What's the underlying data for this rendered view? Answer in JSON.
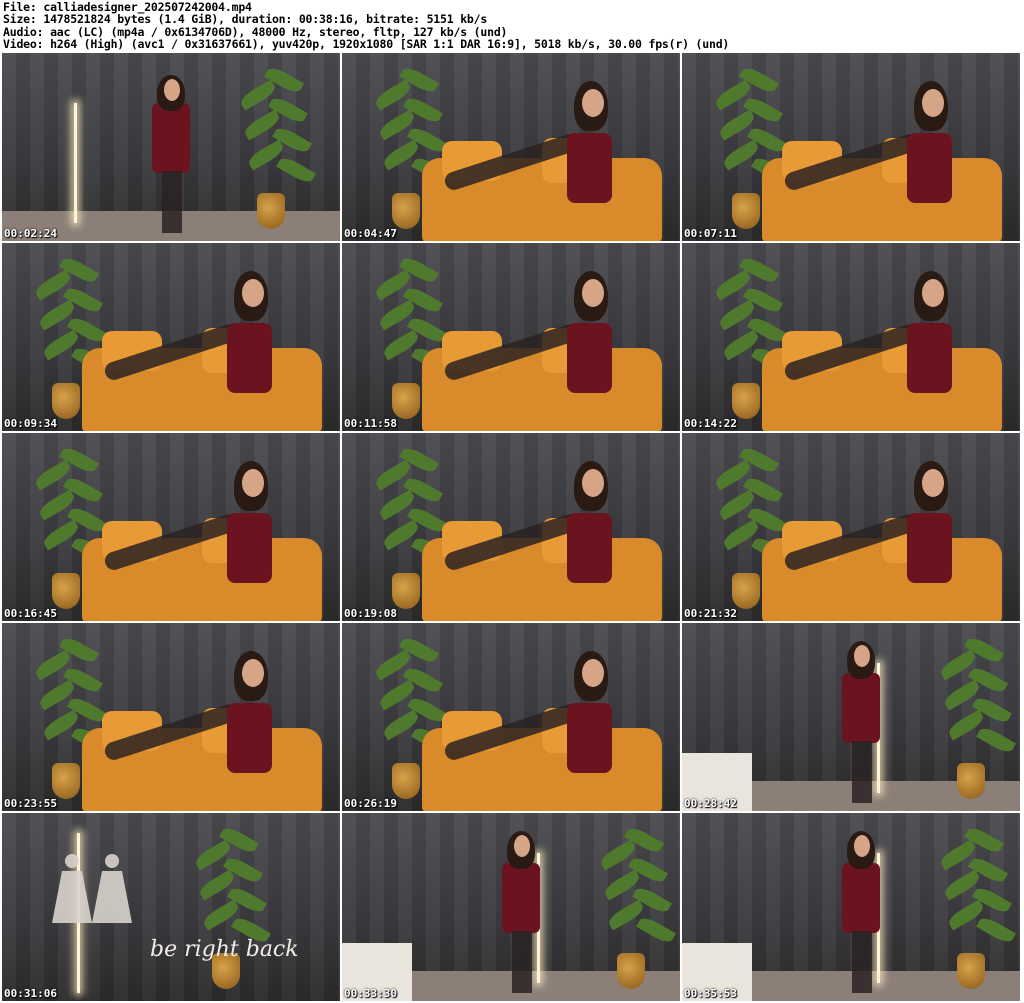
{
  "header": {
    "file_line": "File: calliadesigner_202507242004.mp4",
    "size_line": "Size: 1478521824 bytes (1.4 GiB), duration: 00:38:16, bitrate: 5151 kb/s",
    "audio_line": "Audio: aac (LC) (mp4a / 0x6134706D), 48000 Hz, stereo, fltp, 127 kb/s (und)",
    "video_line": "Video: h264 (High) (avc1 / 0x31637661), yuv420p, 1920x1080 [SAR 1:1 DAR 16:9], 5018 kb/s, 30.00 fps(r) (und)"
  },
  "thumbnails": [
    {
      "timestamp": "00:02:24",
      "scene": "standing"
    },
    {
      "timestamp": "00:04:47",
      "scene": "sofa"
    },
    {
      "timestamp": "00:07:11",
      "scene": "sofa"
    },
    {
      "timestamp": "00:09:34",
      "scene": "sofa"
    },
    {
      "timestamp": "00:11:58",
      "scene": "sofa"
    },
    {
      "timestamp": "00:14:22",
      "scene": "sofa"
    },
    {
      "timestamp": "00:16:45",
      "scene": "sofa"
    },
    {
      "timestamp": "00:19:08",
      "scene": "sofa"
    },
    {
      "timestamp": "00:21:32",
      "scene": "sofa"
    },
    {
      "timestamp": "00:23:55",
      "scene": "sofa"
    },
    {
      "timestamp": "00:26:19",
      "scene": "sofa"
    },
    {
      "timestamp": "00:28:42",
      "scene": "standing-room"
    },
    {
      "timestamp": "00:31:06",
      "scene": "brb",
      "overlay_text": "be right back"
    },
    {
      "timestamp": "00:33:30",
      "scene": "standing-room"
    },
    {
      "timestamp": "00:35:53",
      "scene": "standing-room"
    }
  ]
}
